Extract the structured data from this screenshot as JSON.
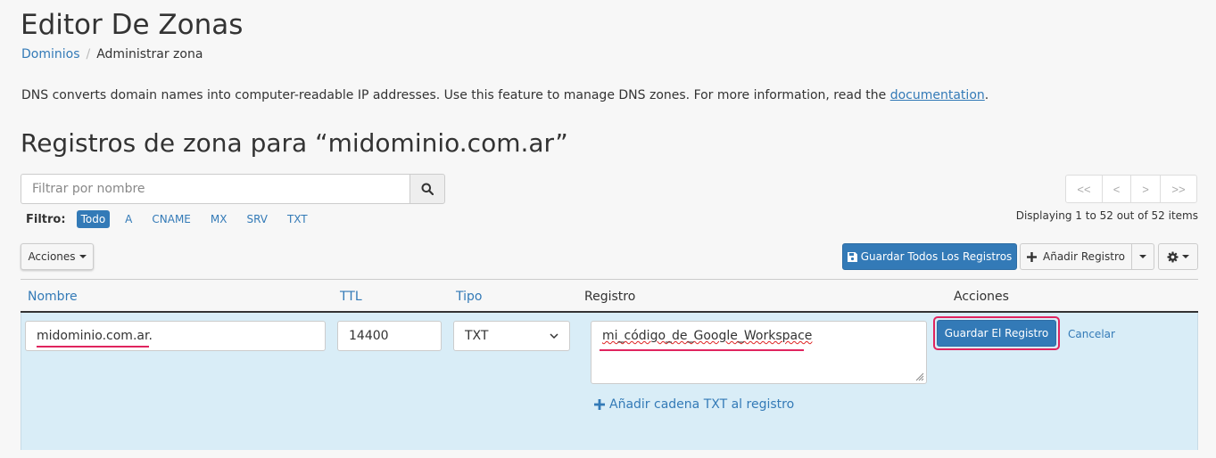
{
  "header": {
    "title": "Editor De Zonas",
    "breadcrumb": {
      "parent": "Dominios",
      "separator": "/",
      "current": "Administrar zona"
    }
  },
  "description": {
    "text": "DNS converts domain names into computer-readable IP addresses. Use this feature to manage DNS zones. For more information, read the ",
    "link": "documentation",
    "suffix": "."
  },
  "zone_title": "Registros de zona para “midominio.com.ar”",
  "search": {
    "placeholder": "Filtrar por nombre",
    "value": ""
  },
  "filters": {
    "label": "Filtro:",
    "items": [
      "Todo",
      "A",
      "CNAME",
      "MX",
      "SRV",
      "TXT"
    ],
    "active": "Todo"
  },
  "pagination": {
    "buttons": [
      "<<",
      "<",
      ">",
      ">>"
    ],
    "status": "Displaying 1 to 52 out of 52 items"
  },
  "toolbar": {
    "actions": "Acciones",
    "save_all": "Guardar Todos Los Registros",
    "add_record": "Añadir Registro"
  },
  "table": {
    "columns": [
      "Nombre",
      "TTL",
      "Tipo",
      "Registro",
      "Acciones"
    ]
  },
  "edit_row": {
    "name": "midominio.com.ar.",
    "ttl": "14400",
    "type": "TXT",
    "record": "mi_código_de_Google_Workspace",
    "add_txt": "Añadir cadena TXT al registro",
    "save": "Guardar El Registro",
    "cancel": "Cancelar"
  },
  "colors": {
    "primary": "#337ab7",
    "row_highlight": "#d9edf7",
    "annotation": "#e0245e"
  },
  "icons": [
    "search-icon",
    "save-icon",
    "plus-icon",
    "caret-down-icon",
    "gear-icon",
    "chevron-down-icon"
  ]
}
